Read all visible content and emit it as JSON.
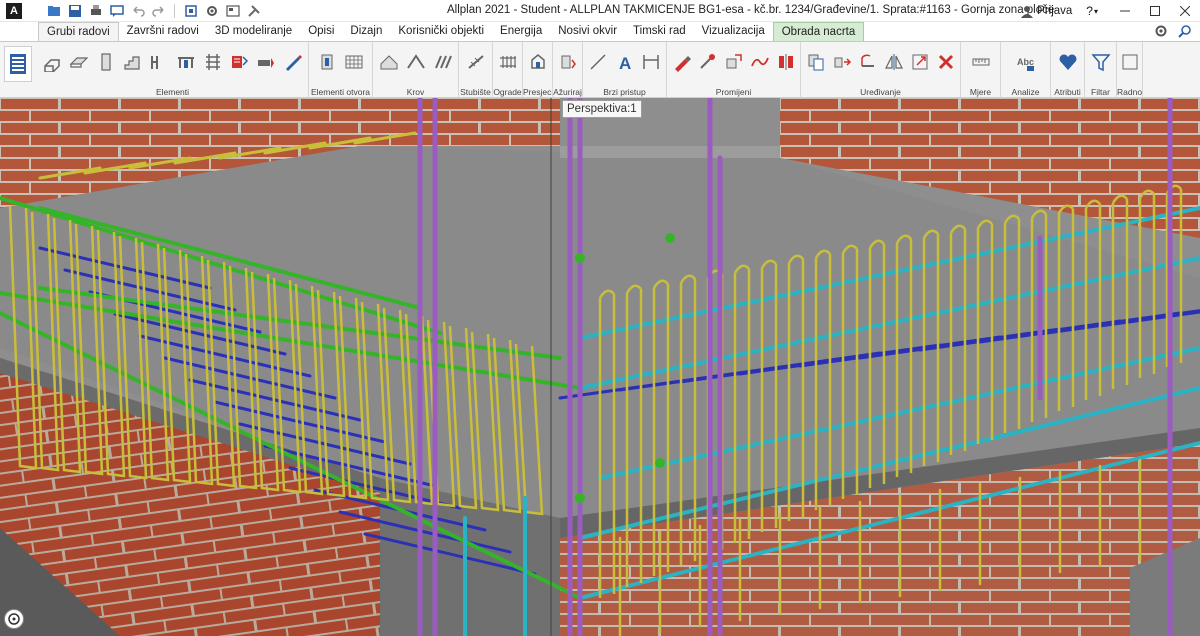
{
  "titlebar": {
    "logo": "A",
    "title": "Allplan 2021 - Student - ALLPLAN TAKMICENJE BG1-esa - kč.br. 1234/Građevine/1. Sprata:#1163 - Gornja zona ploče",
    "user_label": "Prijava",
    "help_label": "?",
    "quick_access": [
      "open-icon",
      "save-icon",
      "print-icon",
      "message-icon",
      "undo-icon",
      "redo-icon",
      "layers-icon",
      "settings-icon",
      "filter-icon",
      "tools-icon"
    ]
  },
  "tabs": [
    {
      "label": "Grubi radovi",
      "state": "active"
    },
    {
      "label": "Završni radovi",
      "state": ""
    },
    {
      "label": "3D modeliranje",
      "state": ""
    },
    {
      "label": "Opisi",
      "state": ""
    },
    {
      "label": "Dizajn",
      "state": ""
    },
    {
      "label": "Korisnički objekti",
      "state": ""
    },
    {
      "label": "Energija",
      "state": ""
    },
    {
      "label": "Nosivi okvir",
      "state": ""
    },
    {
      "label": "Timski rad",
      "state": ""
    },
    {
      "label": "Vizualizacija",
      "state": ""
    },
    {
      "label": "Obrada nacrta",
      "state": "highlight"
    }
  ],
  "ribbon": {
    "groups": [
      {
        "label": "Elementi",
        "width": 272,
        "icons": [
          "wall-icon",
          "slab-icon",
          "column-icon",
          "stair-icon",
          "window-icon",
          "door-icon",
          "grid-icon",
          "opening-icon",
          "beam-icon",
          "pencil-icon"
        ]
      },
      {
        "label": "Elementi otvora",
        "width": 64,
        "icons": [
          "opening-element-icon",
          "window-grid-icon"
        ]
      },
      {
        "label": "Krov",
        "width": 86,
        "icons": [
          "roof-icon",
          "roof-plane-icon",
          "roof-tiles-icon"
        ]
      },
      {
        "label": "Stubište",
        "width": 34,
        "icons": [
          "staircase-icon"
        ]
      },
      {
        "label": "Ograde",
        "width": 30,
        "icons": [
          "railing-icon"
        ]
      },
      {
        "label": "Presjeci",
        "width": 30,
        "icons": [
          "section-icon"
        ]
      },
      {
        "label": "Ažuriraj",
        "width": 30,
        "icons": [
          "update-icon"
        ]
      },
      {
        "label": "Brzi pristup",
        "width": 84,
        "icons": [
          "line-icon",
          "text-icon",
          "dimension-icon"
        ]
      },
      {
        "label": "Promijeni",
        "width": 134,
        "icons": [
          "edit-icon",
          "modify-icon",
          "transform-icon",
          "curve-icon",
          "mirror-icon"
        ]
      },
      {
        "label": "Uređivanje",
        "width": 160,
        "icons": [
          "copy-icon",
          "move-icon",
          "rotate-icon",
          "mirror-edit-icon",
          "stretch-icon",
          "delete-icon"
        ]
      },
      {
        "label": "Mjere",
        "width": 40,
        "icons": [
          "measure-icon"
        ]
      },
      {
        "label": "Analize",
        "width": 50,
        "icons": [
          "analysis-icon"
        ]
      },
      {
        "label": "Atributi",
        "width": 34,
        "icons": [
          "attributes-icon"
        ]
      },
      {
        "label": "Filtar",
        "width": 32,
        "icons": [
          "filter-icon"
        ]
      },
      {
        "label": "Radno",
        "width": 26,
        "icons": [
          "workspace-icon"
        ]
      }
    ]
  },
  "viewport": {
    "tooltip": "Perspektiva:1",
    "colors": {
      "brick": "#b4563a",
      "mortar": "#c9bfb4",
      "concrete": "#7d7d7d",
      "rebar_yellow": "#c9be3a",
      "rebar_green": "#35b42a",
      "rebar_cyan": "#2ab3c4",
      "rebar_blue": "#2a31b6",
      "rebar_purple": "#9a5cc0"
    }
  }
}
